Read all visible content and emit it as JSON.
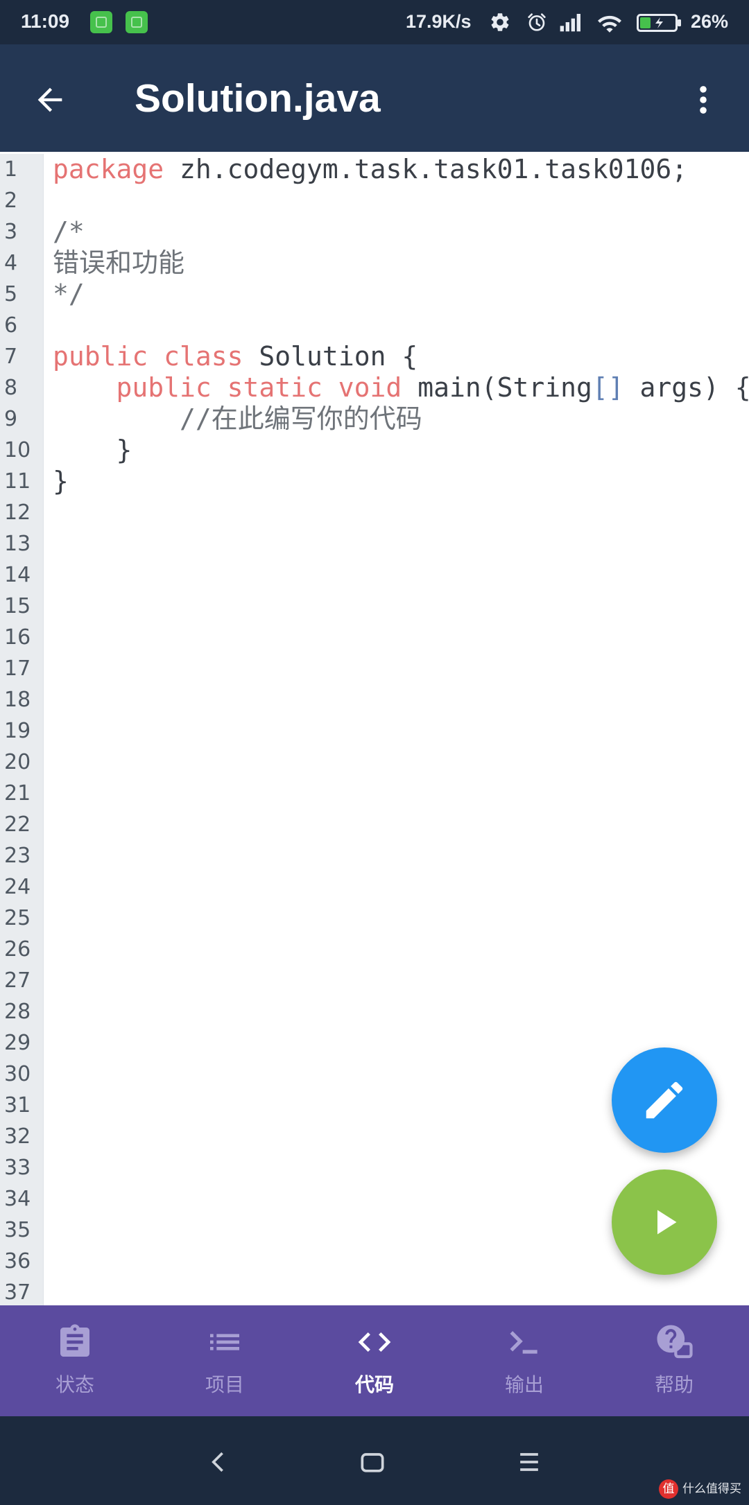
{
  "status_bar": {
    "time": "11:09",
    "network_speed": "17.9K/s",
    "battery_level": "26%",
    "notification_icons": [
      "app-notification-icon",
      "app-notification-icon"
    ],
    "system_icons": [
      "settings-icon",
      "alarm-icon",
      "signal-icon",
      "wifi-icon",
      "battery-icon"
    ]
  },
  "app_bar": {
    "title": "Solution.java",
    "back_icon": "arrow-back-icon",
    "menu_icon": "more-vert-icon"
  },
  "editor": {
    "line_numbers": [
      "1",
      "2",
      "3",
      "4",
      "5",
      "6",
      "7",
      "8",
      "9",
      "10",
      "11",
      "12",
      "13",
      "14",
      "15",
      "16",
      "17",
      "18",
      "19",
      "20",
      "21",
      "22",
      "23",
      "24",
      "25",
      "26",
      "27",
      "28",
      "29",
      "30",
      "31",
      "32",
      "33",
      "34",
      "35",
      "36",
      "37"
    ],
    "lines": [
      [
        {
          "text": "package",
          "kind": "keyword"
        },
        {
          "text": " zh.codegym.task.task01.task0106;",
          "kind": "plain"
        }
      ],
      [],
      [
        {
          "text": "/*",
          "kind": "comment"
        }
      ],
      [
        {
          "text": "错误和功能",
          "kind": "comment"
        }
      ],
      [
        {
          "text": "*/",
          "kind": "comment"
        }
      ],
      [],
      [
        {
          "text": "public class",
          "kind": "keyword"
        },
        {
          "text": " Solution {",
          "kind": "plain"
        }
      ],
      [
        {
          "text": "    public static void",
          "kind": "keyword"
        },
        {
          "text": " main(String",
          "kind": "plain"
        },
        {
          "text": "[]",
          "kind": "bracket"
        },
        {
          "text": " args) {",
          "kind": "plain"
        }
      ],
      [
        {
          "text": "        //在此编写你的代码",
          "kind": "comment"
        }
      ],
      [
        {
          "text": "    }",
          "kind": "plain"
        }
      ],
      [
        {
          "text": "}",
          "kind": "plain"
        }
      ]
    ]
  },
  "fabs": {
    "edit_icon": "pencil-icon",
    "run_icon": "play-icon"
  },
  "bottom_nav": {
    "active_index": 2,
    "items": [
      {
        "label": "状态",
        "icon": "clipboard-icon"
      },
      {
        "label": "项目",
        "icon": "list-icon"
      },
      {
        "label": "代码",
        "icon": "code-icon"
      },
      {
        "label": "输出",
        "icon": "terminal-icon"
      },
      {
        "label": "帮助",
        "icon": "help-icon"
      }
    ]
  },
  "system_nav": {
    "icons": [
      "nav-back-icon",
      "nav-home-icon",
      "nav-recents-icon"
    ]
  },
  "watermark": {
    "logo_char": "值",
    "text": "什么值得买"
  },
  "theme": {
    "status_bg": "#1c2a3e",
    "appbar_bg": "#243754",
    "editor_bg": "#ffffff",
    "gutter_bg": "#e9ecef",
    "line_number": "#4f5862",
    "keyword": "#e57373",
    "plain": "#3a3f47",
    "comment": "#6e7379",
    "bracket": "#5f7fb3",
    "notif": "#46c14c",
    "fab_edit": "#2196f3",
    "fab_run": "#8bc34a",
    "bottom_nav_bg": "#5b4b9f",
    "nav_active": "#ffffff",
    "nav_inactive": "#a89fd4",
    "system_nav_bg": "#1c2a3e"
  }
}
